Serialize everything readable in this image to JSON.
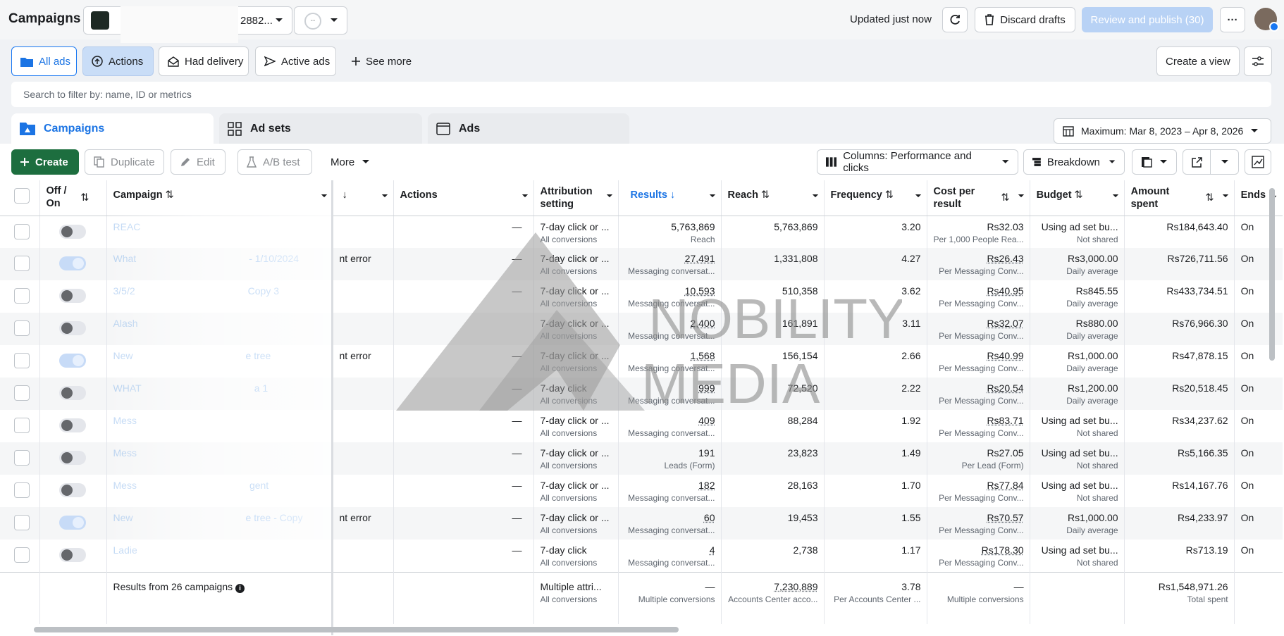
{
  "header": {
    "title": "Campaigns",
    "account_id_fragment": "2882...",
    "account2_label": "--",
    "updated": "Updated just now",
    "discard_label": "Discard drafts",
    "review_label": "Review and publish (30)",
    "more_label": "···"
  },
  "views": {
    "all_ads": "All ads",
    "actions": "Actions",
    "had_delivery": "Had delivery",
    "active_ads": "Active ads",
    "see_more": "See more",
    "create_view": "Create a view"
  },
  "search": {
    "placeholder": "Search to filter by: name, ID or metrics"
  },
  "tabs": {
    "campaigns": "Campaigns",
    "ad_sets": "Ad sets",
    "ads": "Ads"
  },
  "date_range": "Maximum: Mar 8, 2023 – Apr 8, 2026",
  "toolbar": {
    "create": "Create",
    "duplicate": "Duplicate",
    "edit": "Edit",
    "ab_test": "A/B test",
    "more": "More",
    "columns": "Columns: Performance and clicks",
    "breakdown": "Breakdown"
  },
  "columns": {
    "off_on": "Off / On",
    "campaign": "Campaign",
    "actions": "Actions",
    "attribution": "Attribution setting",
    "results": "Results",
    "reach": "Reach",
    "frequency": "Frequency",
    "cost_per_result": "Cost per result",
    "budget": "Budget",
    "amount_spent": "Amount spent",
    "ends": "Ends"
  },
  "rows": [
    {
      "name": "REAC",
      "suffix": "",
      "on": false,
      "status": "",
      "actions": "—",
      "attr": "7-day click or ...",
      "attr_sub": "All conversions",
      "results": "5,763,869",
      "results_sub": "Reach",
      "results_und": false,
      "reach": "5,763,869",
      "freq": "3.20",
      "cpr": "Rs32.03",
      "cpr_sub": "Per 1,000 People Rea...",
      "cpr_und": false,
      "budget": "Using ad set bu...",
      "budget_sub": "Not shared",
      "spent": "Rs184,643.40",
      "ends": "On"
    },
    {
      "name": "What",
      "suffix": "- 1/10/2024",
      "on": true,
      "status": "nt error",
      "actions": "—",
      "attr": "7-day click or ...",
      "attr_sub": "All conversions",
      "results": "27,491",
      "results_sub": "Messaging conversat...",
      "results_und": true,
      "reach": "1,331,808",
      "freq": "4.27",
      "cpr": "Rs26.43",
      "cpr_sub": "Per Messaging Conv...",
      "cpr_und": true,
      "budget": "Rs3,000.00",
      "budget_sub": "Daily average",
      "spent": "Rs726,711.56",
      "ends": "On"
    },
    {
      "name": "3/5/2",
      "suffix": "Copy 3",
      "on": false,
      "status": "",
      "actions": "—",
      "attr": "7-day click or ...",
      "attr_sub": "All conversions",
      "results": "10,593",
      "results_sub": "Messaging conversat...",
      "results_und": true,
      "reach": "510,358",
      "freq": "3.62",
      "cpr": "Rs40.95",
      "cpr_sub": "Per Messaging Conv...",
      "cpr_und": true,
      "budget": "Rs845.55",
      "budget_sub": "Daily average",
      "spent": "Rs433,734.51",
      "ends": "On"
    },
    {
      "name": "Alash",
      "suffix": "",
      "on": false,
      "status": "",
      "actions": "",
      "attr": "7-day click or ...",
      "attr_sub": "All conversions",
      "results": "2,400",
      "results_sub": "Messaging conversat...",
      "results_und": true,
      "reach": "161,891",
      "freq": "3.11",
      "cpr": "Rs32.07",
      "cpr_sub": "Per Messaging Conv...",
      "cpr_und": true,
      "budget": "Rs880.00",
      "budget_sub": "Daily average",
      "spent": "Rs76,966.30",
      "ends": "On"
    },
    {
      "name": "New",
      "suffix": "e tree",
      "on": true,
      "status": "nt error",
      "actions": "—",
      "attr": "7-day click or ...",
      "attr_sub": "All conversions",
      "results": "1,568",
      "results_sub": "Messaging conversat...",
      "results_und": true,
      "reach": "156,154",
      "freq": "2.66",
      "cpr": "Rs40.99",
      "cpr_sub": "Per Messaging Conv...",
      "cpr_und": true,
      "budget": "Rs1,000.00",
      "budget_sub": "Daily average",
      "spent": "Rs47,878.15",
      "ends": "On"
    },
    {
      "name": "WHAT",
      "suffix": "a 1",
      "on": false,
      "status": "",
      "actions": "—",
      "attr": "7-day click",
      "attr_sub": "All conversions",
      "results": "999",
      "results_sub": "Messaging conversat...",
      "results_und": true,
      "reach": "72,520",
      "freq": "2.22",
      "cpr": "Rs20.54",
      "cpr_sub": "Per Messaging Conv...",
      "cpr_und": true,
      "budget": "Rs1,200.00",
      "budget_sub": "Daily average",
      "spent": "Rs20,518.45",
      "ends": "On"
    },
    {
      "name": "Mess",
      "suffix": "",
      "on": false,
      "status": "",
      "actions": "—",
      "attr": "7-day click or ...",
      "attr_sub": "All conversions",
      "results": "409",
      "results_sub": "Messaging conversat...",
      "results_und": true,
      "reach": "88,284",
      "freq": "1.92",
      "cpr": "Rs83.71",
      "cpr_sub": "Per Messaging Conv...",
      "cpr_und": true,
      "budget": "Using ad set bu...",
      "budget_sub": "Not shared",
      "spent": "Rs34,237.62",
      "ends": "On"
    },
    {
      "name": "Mess",
      "suffix": "",
      "on": false,
      "status": "",
      "actions": "—",
      "attr": "7-day click or ...",
      "attr_sub": "All conversions",
      "results": "191",
      "results_sub": "Leads (Form)",
      "results_und": false,
      "reach": "23,823",
      "freq": "1.49",
      "cpr": "Rs27.05",
      "cpr_sub": "Per Lead (Form)",
      "cpr_und": false,
      "budget": "Using ad set bu...",
      "budget_sub": "Not shared",
      "spent": "Rs5,166.35",
      "ends": "On"
    },
    {
      "name": "Mess",
      "suffix": "gent",
      "on": false,
      "status": "",
      "actions": "—",
      "attr": "7-day click or ...",
      "attr_sub": "All conversions",
      "results": "182",
      "results_sub": "Messaging conversat...",
      "results_und": true,
      "reach": "28,163",
      "freq": "1.70",
      "cpr": "Rs77.84",
      "cpr_sub": "Per Messaging Conv...",
      "cpr_und": true,
      "budget": "Using ad set bu...",
      "budget_sub": "Not shared",
      "spent": "Rs14,167.76",
      "ends": "On"
    },
    {
      "name": "New",
      "suffix": "e tree - Copy",
      "on": true,
      "status": "nt error",
      "actions": "—",
      "attr": "7-day click or ...",
      "attr_sub": "All conversions",
      "results": "60",
      "results_sub": "Messaging conversat...",
      "results_und": true,
      "reach": "19,453",
      "freq": "1.55",
      "cpr": "Rs70.57",
      "cpr_sub": "Per Messaging Conv...",
      "cpr_und": true,
      "budget": "Rs1,000.00",
      "budget_sub": "Daily average",
      "spent": "Rs4,233.97",
      "ends": "On"
    },
    {
      "name": "Ladie",
      "suffix": "",
      "on": false,
      "status": "",
      "actions": "—",
      "attr": "7-day click",
      "attr_sub": "All conversions",
      "results": "4",
      "results_sub": "Messaging conversat...",
      "results_und": true,
      "reach": "2,738",
      "freq": "1.17",
      "cpr": "Rs178.30",
      "cpr_sub": "Per Messaging Conv...",
      "cpr_und": true,
      "budget": "Using ad set bu...",
      "budget_sub": "Not shared",
      "spent": "Rs713.19",
      "ends": "On"
    }
  ],
  "footer": {
    "label": "Results from 26 campaigns",
    "attr": "Multiple attri...",
    "attr_sub": "All conversions",
    "results": "—",
    "results_sub": "Multiple conversions",
    "reach": "7,230,889",
    "reach_sub": "Accounts Center acco...",
    "freq": "3.78",
    "freq_sub": "Per Accounts Center ...",
    "cpr": "—",
    "cpr_sub": "Multiple conversions",
    "spent": "Rs1,548,971.26",
    "spent_sub": "Total spent"
  },
  "watermark": {
    "line1": "NOBILITY",
    "line2": "MEDIA"
  },
  "colors": {
    "brand_blue": "#1b74e4",
    "create_green": "#1d6e3f",
    "review_disabled": "#b8d2f5"
  }
}
